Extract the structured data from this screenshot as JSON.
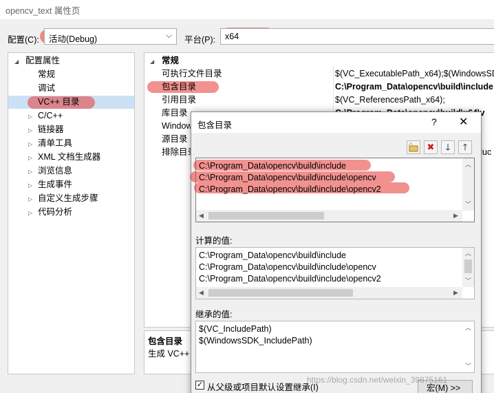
{
  "window": {
    "title": "opencv_text 属性页"
  },
  "config": {
    "label": "配置(C):",
    "value": "活动(Debug)",
    "platform_label": "平台(P):",
    "platform_value": "x64"
  },
  "tree": {
    "root": "配置属性",
    "items": [
      "常规",
      "调试",
      "VC++ 目录",
      "C/C++",
      "链接器",
      "清单工具",
      "XML 文档生成器",
      "浏览信息",
      "生成事件",
      "自定义生成步骤",
      "代码分析"
    ],
    "selected": "VC++ 目录"
  },
  "grid": {
    "category": "常规",
    "rows": [
      {
        "name": "可执行文件目录",
        "value": "$(VC_ExecutablePath_x64);$(WindowsSDK"
      },
      {
        "name": "包含目录",
        "value": "C:\\Program_Data\\opencv\\build\\include"
      },
      {
        "name": "引用目录",
        "value": "$(VC_ReferencesPath_x64);"
      },
      {
        "name": "库目录",
        "value": "C:\\Program_Data\\opencv\\build\\x64\\v"
      },
      {
        "name": "Window",
        "value": ""
      },
      {
        "name": "源目录",
        "value": ""
      },
      {
        "name": "排除目录",
        "value": "cluc"
      }
    ]
  },
  "description": {
    "title": "包含目录",
    "text": "生成 VC++"
  },
  "dialog": {
    "title": "包含目录",
    "help": "?",
    "close": "✕",
    "entries": [
      "C:\\Program_Data\\opencv\\build\\include",
      "C:\\Program_Data\\opencv\\build\\include\\opencv",
      "C:\\Program_Data\\opencv\\build\\include\\opencv2"
    ],
    "evaluated_label": "计算的值:",
    "evaluated": [
      "C:\\Program_Data\\opencv\\build\\include",
      "C:\\Program_Data\\opencv\\build\\include\\opencv",
      "C:\\Program_Data\\opencv\\build\\include\\opencv2"
    ],
    "inherited_label": "继承的值:",
    "inherited": [
      "$(VC_IncludePath)",
      "$(WindowsSDK_IncludePath)"
    ],
    "inherit_checkbox_label": "从父级或项目默认设置继承(I)",
    "inherit_checked": true,
    "macros_button": "宏(M) >>"
  },
  "watermark": "https://blog.csdn.net/weixin_39875161",
  "colors": {
    "highlight": "#e53935",
    "selection": "#cce1f5"
  }
}
